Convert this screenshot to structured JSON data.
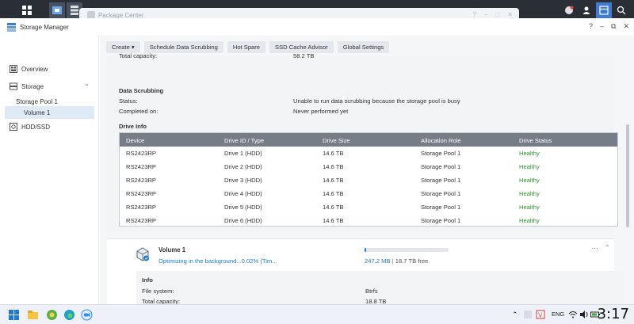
{
  "package_window": {
    "title": "Package Center",
    "controls": [
      "?",
      "–",
      "□",
      "✕"
    ]
  },
  "window": {
    "title": "Storage Manager",
    "controls": [
      "?",
      "–",
      "⧉",
      "✕"
    ]
  },
  "sidebar": {
    "items": [
      {
        "label": "Overview"
      },
      {
        "label": "Storage"
      },
      {
        "label": "Storage Pool 1"
      },
      {
        "label": "Volume 1"
      },
      {
        "label": "HDD/SSD"
      }
    ]
  },
  "toolbar": {
    "buttons": [
      "Create ▾",
      "Schedule Data Scrubbing",
      "Hot Spare",
      "SSD Cache Advisor",
      "Global Settings"
    ]
  },
  "pool": {
    "total_capacity_label": "Total capacity:",
    "total_capacity_value": "58.2 TB",
    "scrubbing_title": "Data Scrubbing",
    "status_label": "Status:",
    "status_value": "Unable to run data scrubbing because the storage pool is busy",
    "completed_label": "Completed on:",
    "completed_value": "Never performed yet",
    "drive_info_title": "Drive Info",
    "columns": [
      "Device",
      "Drive ID / Type",
      "Drive Size",
      "Allocation Role",
      "Drive Status"
    ],
    "rows": [
      [
        "RS2423RP",
        "Drive 1 (HDD)",
        "14.6 TB",
        "Storage Pool 1",
        "Healthy"
      ],
      [
        "RS2423RP",
        "Drive 2 (HDD)",
        "14.6 TB",
        "Storage Pool 1",
        "Healthy"
      ],
      [
        "RS2423RP",
        "Drive 3 (HDD)",
        "14.6 TB",
        "Storage Pool 1",
        "Healthy"
      ],
      [
        "RS2423RP",
        "Drive 4 (HDD)",
        "14.6 TB",
        "Storage Pool 1",
        "Healthy"
      ],
      [
        "RS2423RP",
        "Drive 5 (HDD)",
        "14.6 TB",
        "Storage Pool 1",
        "Healthy"
      ],
      [
        "RS2423RP",
        "Drive 6 (HDD)",
        "14.6 TB",
        "Storage Pool 1",
        "Healthy"
      ]
    ]
  },
  "volume": {
    "name": "Volume 1",
    "status": "Optimizing in the background...0.02% (Tim...",
    "used": "247.2 MB",
    "separator": "|",
    "free": "18.7 TB free",
    "usage_fraction": 0.02,
    "info_title": "Info",
    "fs_label": "File system:",
    "fs_value": "Btrfs",
    "cap_label": "Total capacity:",
    "cap_value": "18.8 TB",
    "more": "···",
    "collapse": "⌃"
  },
  "taskbar": {
    "lang": "ENG",
    "clock": "3:17"
  },
  "colors": {
    "accent": "#1f7ad6",
    "healthy": "#2a9a2a",
    "table_header": "#767d87"
  }
}
